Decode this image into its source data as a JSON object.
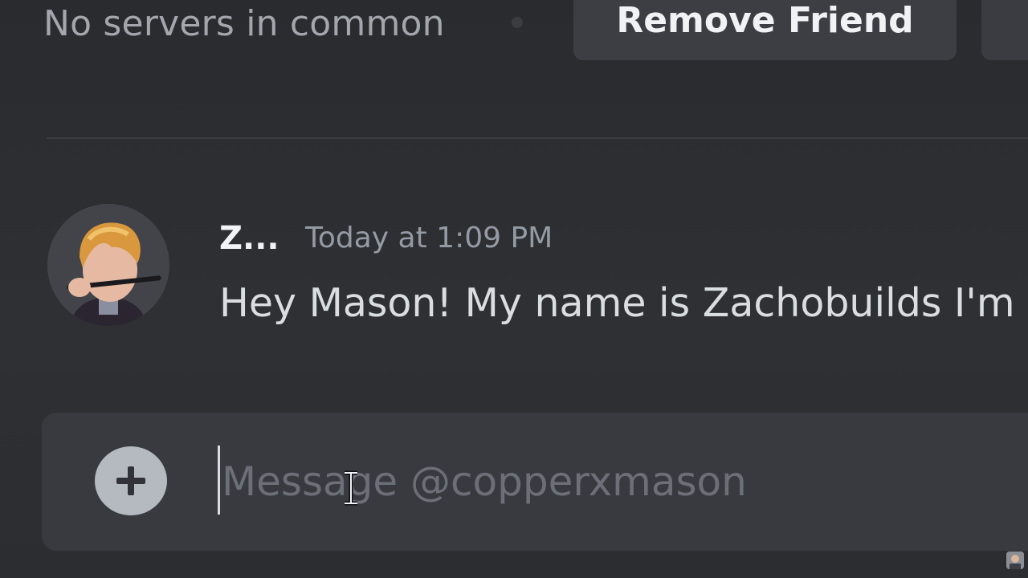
{
  "profile_header": {
    "mutual_servers_text": "No servers in common",
    "remove_friend_label": "Remove Friend"
  },
  "message": {
    "author": "Z...",
    "timestamp": "Today at 1:09 PM",
    "content": "Hey Mason! My name is Zachobuilds I'm"
  },
  "composer": {
    "placeholder": "Message @copperxmason",
    "attach_icon": "plus-circle-icon"
  },
  "colors": {
    "background": "#2b2d31",
    "composer": "#383a40",
    "button": "#3c3e44",
    "muted_text": "#949ba4"
  }
}
